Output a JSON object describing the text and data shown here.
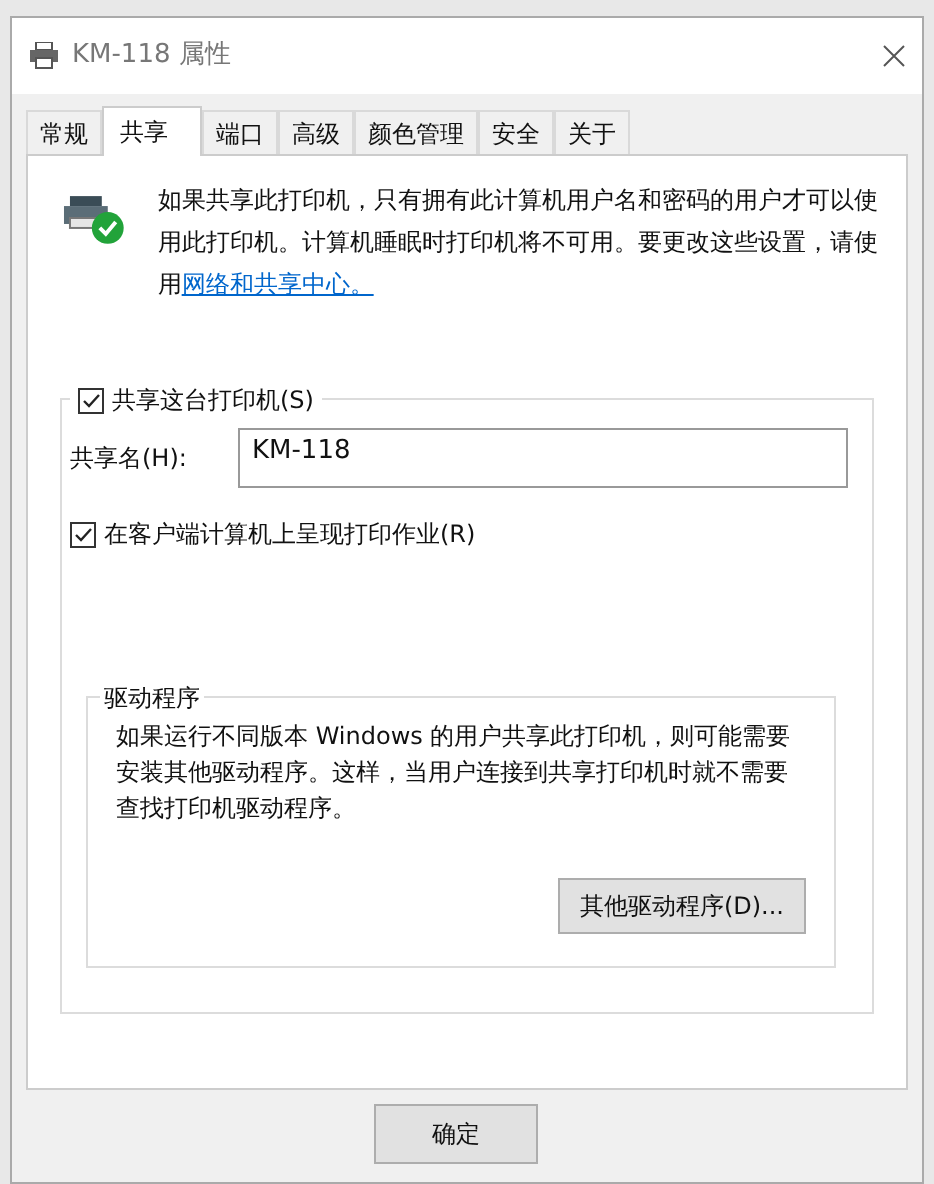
{
  "window": {
    "title": "KM-118 属性"
  },
  "tabs": [
    {
      "label": "常规",
      "selected": false
    },
    {
      "label": "共享",
      "selected": true
    },
    {
      "label": "端口",
      "selected": false
    },
    {
      "label": "高级",
      "selected": false
    },
    {
      "label": "颜色管理",
      "selected": false
    },
    {
      "label": "安全",
      "selected": false
    },
    {
      "label": "关于",
      "selected": false
    }
  ],
  "sharing": {
    "intro": "如果共享此打印机，只有拥有此计算机用户名和密码的用户才可以使用此打印机。计算机睡眠时打印机将不可用。要更改这些设置，请使用",
    "link": "网络和共享中心。",
    "share_checkbox": {
      "label": "共享这台打印机(S)",
      "checked": true
    },
    "share_name": {
      "label": "共享名(H):",
      "value": "KM-118"
    },
    "render_checkbox": {
      "label": "在客户端计算机上呈现打印作业(R)",
      "checked": true
    }
  },
  "drivers": {
    "title": "驱动程序",
    "text": "如果运行不同版本 Windows 的用户共享此打印机，则可能需要安装其他驱动程序。这样，当用户连接到共享打印机时就不需要查找打印机驱动程序。",
    "button": "其他驱动程序(D)..."
  },
  "buttons": [
    "确定"
  ]
}
